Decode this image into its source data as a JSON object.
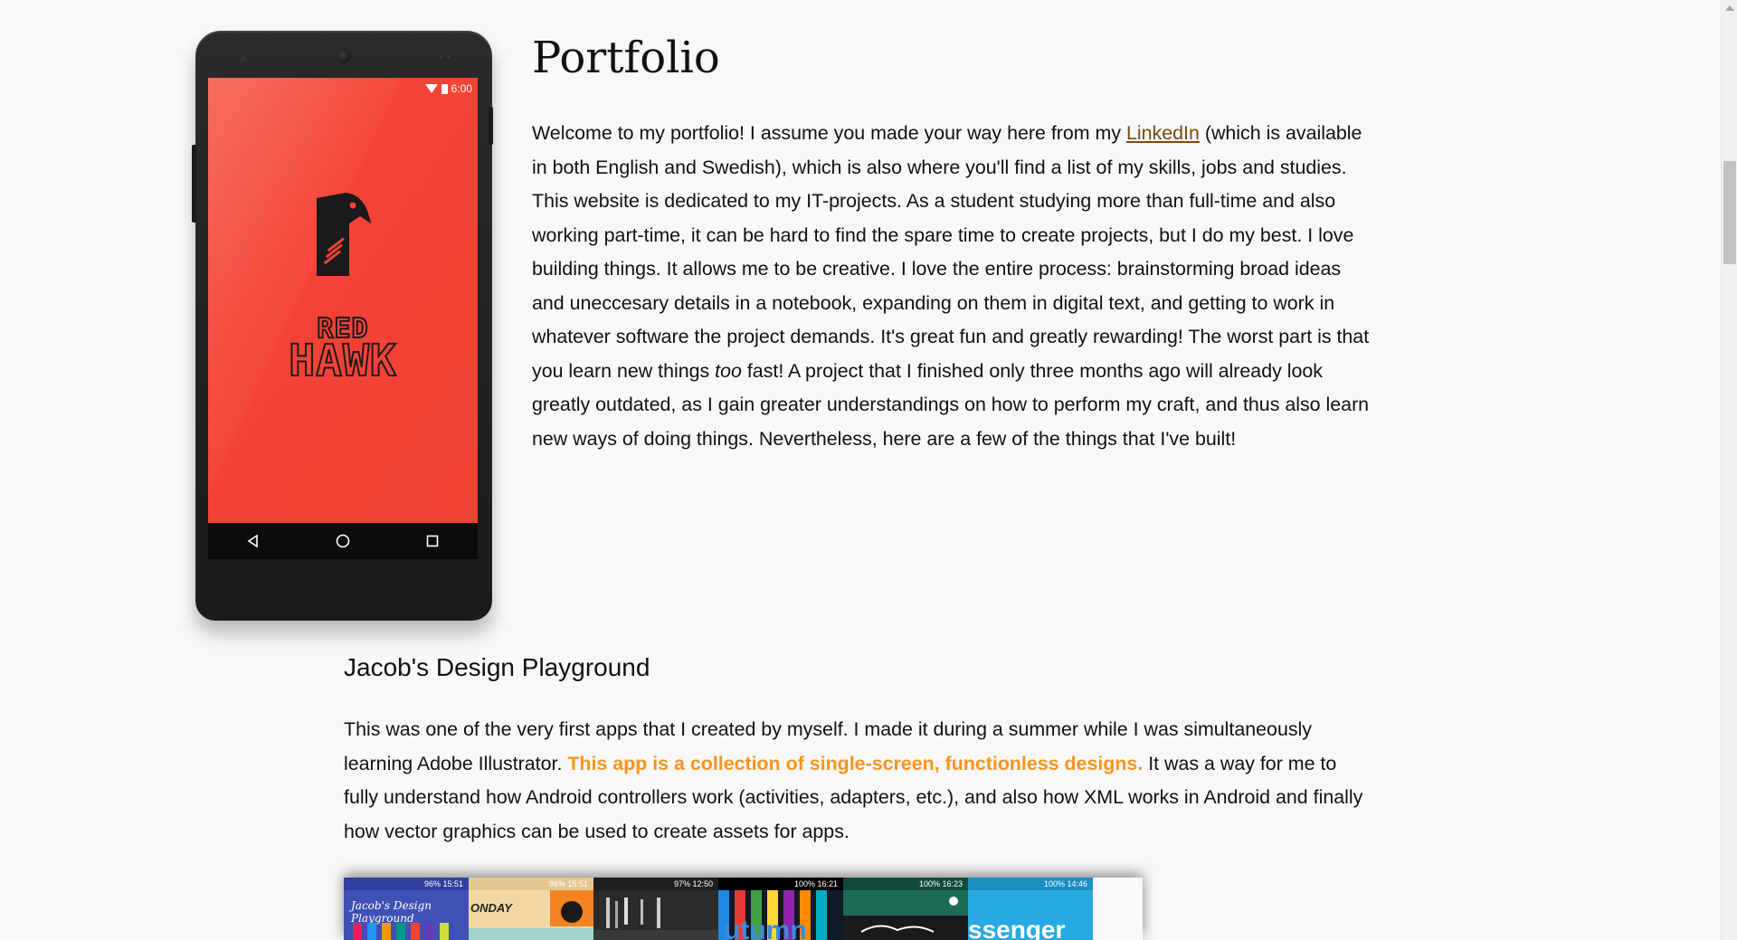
{
  "phone": {
    "status_time": "6:00",
    "brand_line1": "RED",
    "brand_line2": "HAWK",
    "colors": {
      "screen": "#f44336",
      "body": "#1a1a1a"
    },
    "nav_icons": [
      "back-icon",
      "home-icon",
      "recents-icon"
    ]
  },
  "intro": {
    "title": "Portfolio",
    "p_before_link": "Welcome to my portfolio! I assume you made your way here from my ",
    "link_text": "LinkedIn",
    "p_after_link": " (which is available in both English and Swedish), which is also where you'll find a list of my skills, jobs and studies. This website is dedicated to my IT-projects. As a student studying more than full-time and also working part-time, it can be hard to find the spare time to create projects, but I do my best. I love building things. It allows me to be creative. I love the entire process: brainstorming broad ideas and uneccesary details in a notebook, expanding on them in digital text, and getting to work in whatever software the project demands. It's great fun and greatly rewarding! The worst part is that you learn new things ",
    "emphasis": "too",
    "p_after_emphasis": " fast! A project that I finished only three months ago will already look greatly outdated, as I gain greater understandings on how to perform my craft, and thus also learn new ways of doing things. Nevertheless, here are a few of the things that I've built!"
  },
  "section": {
    "title": "Jacob's Design Playground",
    "text_before": "This was one of the very first apps that I created by myself. I made it during a summer while I was simultaneously learning Adobe Illustrator. ",
    "highlight": "This app is a collection of single-screen, functionless designs.",
    "text_after": " It was a way for me to fully understand how Android controllers work (activities, adapters, etc.), and also how XML works in Android and finally how vector graphics can be used to create assets for apps.",
    "highlight_color": "#f7941d"
  },
  "screenshots": [
    {
      "time": "96% 15:51",
      "label": "Jacob's Design Playground",
      "bg": "#3f51b5"
    },
    {
      "time": "96% 15:51",
      "label": "ONDAY",
      "bg": "#f2d7a5"
    },
    {
      "time": "97% 12:50",
      "label": "",
      "bg": "#2b2b2b"
    },
    {
      "time": "100% 16:21",
      "label": "utumn",
      "bg": "#111827"
    },
    {
      "time": "100% 16:23",
      "label": "",
      "bg": "#1d6b56"
    },
    {
      "time": "100% 14:46",
      "label": "ssenger",
      "bg": "#29a9e1"
    }
  ]
}
